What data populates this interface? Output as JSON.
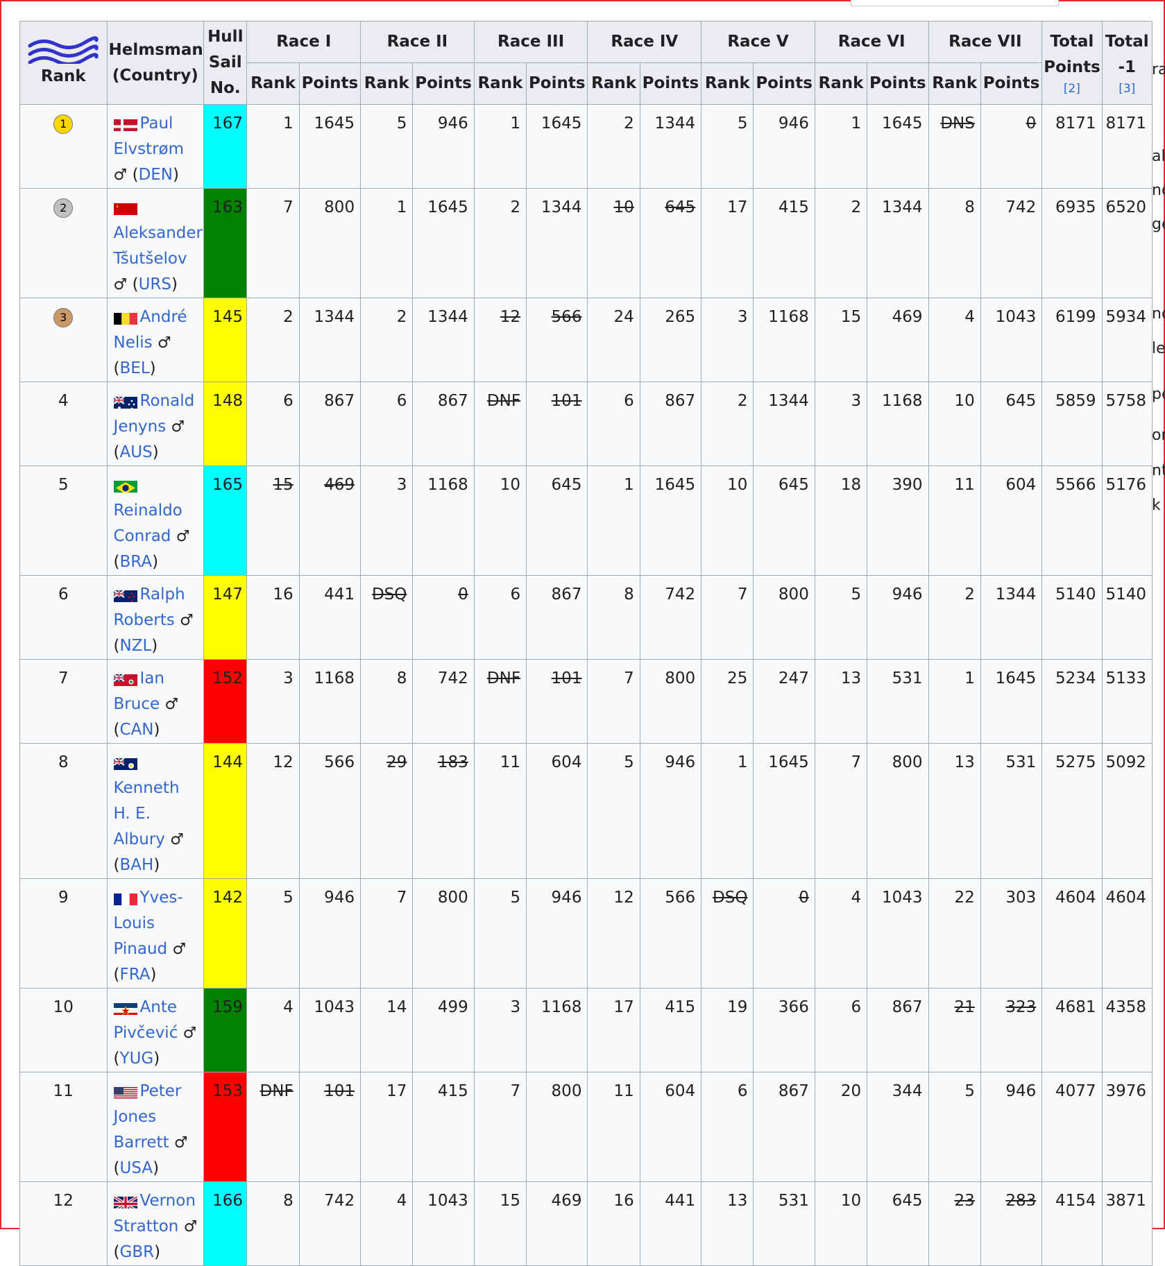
{
  "header": {
    "rank": "Rank",
    "helmsman": "Helmsman",
    "country": "(Country)",
    "hull": [
      "Hull",
      "Sail",
      "No."
    ],
    "races": [
      "Race I",
      "Race II",
      "Race III",
      "Race IV",
      "Race V",
      "Race VI",
      "Race VII"
    ],
    "sub_rank": "Rank",
    "sub_points": "Points",
    "total_points": [
      "Total",
      "Points"
    ],
    "total_points_ref": "[2]",
    "total_minus": [
      "Total",
      "-1"
    ],
    "total_minus_ref": "[3]"
  },
  "side_fragments": [
    "ra",
    "al",
    "nd",
    "ge",
    "nd",
    "le",
    "pe",
    "or",
    "nt",
    "k"
  ],
  "rows": [
    {
      "rank": "1",
      "medal": "gold",
      "name_parts": [
        "Paul",
        "Elvstrøm"
      ],
      "country": "DEN",
      "sail": "167",
      "sail_color": "cyan",
      "races": [
        [
          "1",
          "1645",
          false
        ],
        [
          "5",
          "946",
          false
        ],
        [
          "1",
          "1645",
          false
        ],
        [
          "2",
          "1344",
          false
        ],
        [
          "5",
          "946",
          false
        ],
        [
          "1",
          "1645",
          false
        ],
        [
          "DNS",
          "0",
          true
        ]
      ],
      "total": "8171",
      "total_minus": "8171"
    },
    {
      "rank": "2",
      "medal": "silver",
      "name_parts": [
        "Aleksander",
        "Tšutšelov"
      ],
      "country": "URS",
      "sail": "163",
      "sail_color": "green",
      "races": [
        [
          "7",
          "800",
          false
        ],
        [
          "1",
          "1645",
          false
        ],
        [
          "2",
          "1344",
          false
        ],
        [
          "10",
          "645",
          true
        ],
        [
          "17",
          "415",
          false
        ],
        [
          "2",
          "1344",
          false
        ],
        [
          "8",
          "742",
          false
        ]
      ],
      "total": "6935",
      "total_minus": "6520"
    },
    {
      "rank": "3",
      "medal": "bronze",
      "name_parts": [
        "André",
        "Nelis"
      ],
      "country": "BEL",
      "sail": "145",
      "sail_color": "yellow",
      "races": [
        [
          "2",
          "1344",
          false
        ],
        [
          "2",
          "1344",
          false
        ],
        [
          "12",
          "566",
          true
        ],
        [
          "24",
          "265",
          false
        ],
        [
          "3",
          "1168",
          false
        ],
        [
          "15",
          "469",
          false
        ],
        [
          "4",
          "1043",
          false
        ]
      ],
      "total": "6199",
      "total_minus": "5934"
    },
    {
      "rank": "4",
      "medal": "",
      "name_parts": [
        "Ronald",
        "Jenyns"
      ],
      "country": "AUS",
      "sail": "148",
      "sail_color": "yellow",
      "races": [
        [
          "6",
          "867",
          false
        ],
        [
          "6",
          "867",
          false
        ],
        [
          "DNF",
          "101",
          true
        ],
        [
          "6",
          "867",
          false
        ],
        [
          "2",
          "1344",
          false
        ],
        [
          "3",
          "1168",
          false
        ],
        [
          "10",
          "645",
          false
        ]
      ],
      "total": "5859",
      "total_minus": "5758"
    },
    {
      "rank": "5",
      "medal": "",
      "name_parts": [
        "Reinaldo",
        "Conrad"
      ],
      "country": "BRA",
      "sail": "165",
      "sail_color": "cyan",
      "races": [
        [
          "15",
          "469",
          true
        ],
        [
          "3",
          "1168",
          false
        ],
        [
          "10",
          "645",
          false
        ],
        [
          "1",
          "1645",
          false
        ],
        [
          "10",
          "645",
          false
        ],
        [
          "18",
          "390",
          false
        ],
        [
          "11",
          "604",
          false
        ]
      ],
      "total": "5566",
      "total_minus": "5176"
    },
    {
      "rank": "6",
      "medal": "",
      "name_parts": [
        "Ralph",
        "Roberts"
      ],
      "country": "NZL",
      "sail": "147",
      "sail_color": "yellow",
      "races": [
        [
          "16",
          "441",
          false
        ],
        [
          "DSQ",
          "0",
          true
        ],
        [
          "6",
          "867",
          false
        ],
        [
          "8",
          "742",
          false
        ],
        [
          "7",
          "800",
          false
        ],
        [
          "5",
          "946",
          false
        ],
        [
          "2",
          "1344",
          false
        ]
      ],
      "total": "5140",
      "total_minus": "5140"
    },
    {
      "rank": "7",
      "medal": "",
      "name_parts": [
        "Ian",
        "Bruce"
      ],
      "country": "CAN",
      "sail": "152",
      "sail_color": "red",
      "races": [
        [
          "3",
          "1168",
          false
        ],
        [
          "8",
          "742",
          false
        ],
        [
          "DNF",
          "101",
          true
        ],
        [
          "7",
          "800",
          false
        ],
        [
          "25",
          "247",
          false
        ],
        [
          "13",
          "531",
          false
        ],
        [
          "1",
          "1645",
          false
        ]
      ],
      "total": "5234",
      "total_minus": "5133"
    },
    {
      "rank": "8",
      "medal": "",
      "name_parts": [
        "Kenneth H.",
        "E. Albury"
      ],
      "country": "BAH",
      "sail": "144",
      "sail_color": "yellow",
      "races": [
        [
          "12",
          "566",
          false
        ],
        [
          "29",
          "183",
          true
        ],
        [
          "11",
          "604",
          false
        ],
        [
          "5",
          "946",
          false
        ],
        [
          "1",
          "1645",
          false
        ],
        [
          "7",
          "800",
          false
        ],
        [
          "13",
          "531",
          false
        ]
      ],
      "total": "5275",
      "total_minus": "5092"
    },
    {
      "rank": "9",
      "medal": "",
      "name_parts": [
        "Yves-",
        "Louis",
        "Pinaud"
      ],
      "country": "FRA",
      "sail": "142",
      "sail_color": "yellow",
      "races": [
        [
          "5",
          "946",
          false
        ],
        [
          "7",
          "800",
          false
        ],
        [
          "5",
          "946",
          false
        ],
        [
          "12",
          "566",
          false
        ],
        [
          "DSQ",
          "0",
          true
        ],
        [
          "4",
          "1043",
          false
        ],
        [
          "22",
          "303",
          false
        ]
      ],
      "total": "4604",
      "total_minus": "4604"
    },
    {
      "rank": "10",
      "medal": "",
      "name_parts": [
        "Ante",
        "Pivčević"
      ],
      "country": "YUG",
      "sail": "159",
      "sail_color": "green",
      "races": [
        [
          "4",
          "1043",
          false
        ],
        [
          "14",
          "499",
          false
        ],
        [
          "3",
          "1168",
          false
        ],
        [
          "17",
          "415",
          false
        ],
        [
          "19",
          "366",
          false
        ],
        [
          "6",
          "867",
          false
        ],
        [
          "21",
          "323",
          true
        ]
      ],
      "total": "4681",
      "total_minus": "4358"
    },
    {
      "rank": "11",
      "medal": "",
      "name_parts": [
        "Peter",
        "Jones",
        "Barrett"
      ],
      "country": "USA",
      "sail": "153",
      "sail_color": "red",
      "races": [
        [
          "DNF",
          "101",
          true
        ],
        [
          "17",
          "415",
          false
        ],
        [
          "7",
          "800",
          false
        ],
        [
          "11",
          "604",
          false
        ],
        [
          "6",
          "867",
          false
        ],
        [
          "20",
          "344",
          false
        ],
        [
          "5",
          "946",
          false
        ]
      ],
      "total": "4077",
      "total_minus": "3976"
    },
    {
      "rank": "12",
      "medal": "",
      "name_parts": [
        "Vernon",
        "Stratton"
      ],
      "country": "GBR",
      "sail": "166",
      "sail_color": "cyan",
      "races": [
        [
          "8",
          "742",
          false
        ],
        [
          "4",
          "1043",
          false
        ],
        [
          "15",
          "469",
          false
        ],
        [
          "16",
          "441",
          false
        ],
        [
          "13",
          "531",
          false
        ],
        [
          "10",
          "645",
          false
        ],
        [
          "23",
          "283",
          true
        ]
      ],
      "total": "4154",
      "total_minus": "3871"
    }
  ]
}
